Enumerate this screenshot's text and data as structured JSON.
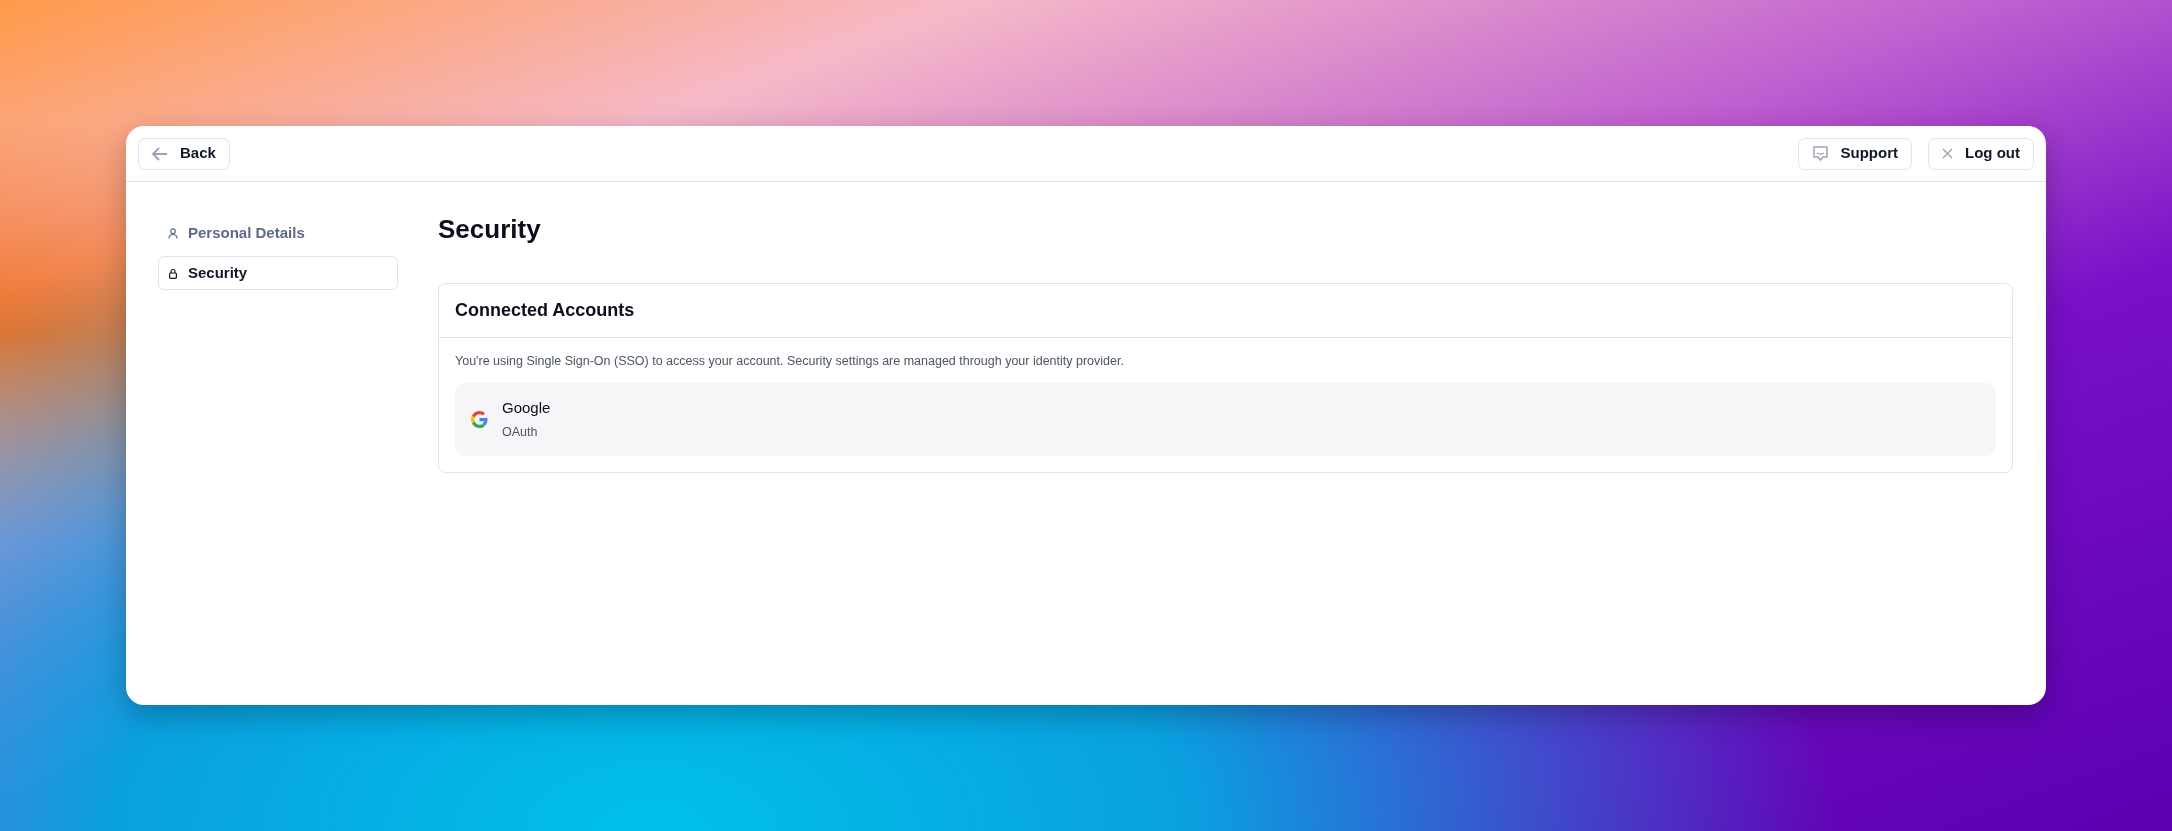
{
  "header": {
    "back": "Back",
    "support": "Support",
    "logout": "Log out"
  },
  "sidebar": {
    "items": [
      {
        "label": "Personal Details",
        "selected": false
      },
      {
        "label": "Security",
        "selected": true
      }
    ]
  },
  "page_title": "Security",
  "card": {
    "title": "Connected Accounts",
    "description": "You're using Single Sign-On (SSO) to access your account. Security settings are managed through your identity provider.",
    "accounts": [
      {
        "name": "Google",
        "type": "OAuth"
      }
    ]
  }
}
